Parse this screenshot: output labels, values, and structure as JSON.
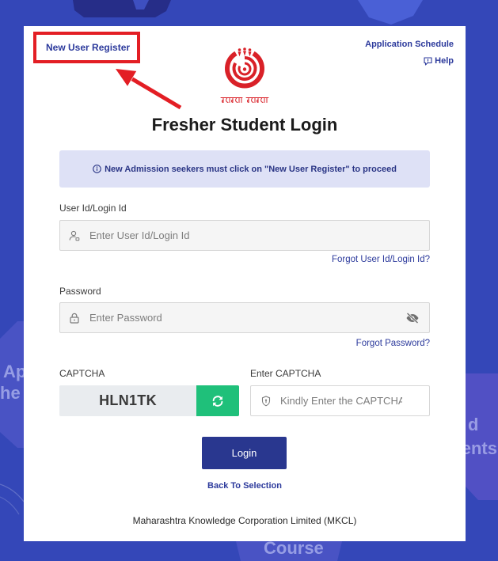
{
  "colors": {
    "page_background": "#3447b8",
    "link": "#2c3a9c",
    "highlight_red": "#e31e24",
    "notice_background": "#dee1f6",
    "notice_text": "#2a3585",
    "refresh_button": "#1fc07a",
    "login_button": "#29378f"
  },
  "background": {
    "left_text_1": "Ap",
    "left_text_2": "he",
    "right_text_1": "d",
    "right_text_2": "ents",
    "bottom_text": "Course"
  },
  "header": {
    "new_user_register": "New User Register",
    "application_schedule": "Application Schedule",
    "help": "Help",
    "help_icon": "help-icon"
  },
  "logo": {
    "icon": "university-logo",
    "tagline": "ज्ञानगंगा घरोघरी"
  },
  "title": "Fresher Student Login",
  "notice": {
    "icon": "info-icon",
    "text": "New Admission seekers must click on \"New User Register\" to proceed"
  },
  "form": {
    "user_id": {
      "label": "User Id/Login Id",
      "placeholder": "Enter User Id/Login Id",
      "value": "",
      "icon": "user-icon",
      "forgot_link": "Forgot User Id/Login Id?"
    },
    "password": {
      "label": "Password",
      "placeholder": "Enter Password",
      "value": "",
      "icon": "lock-icon",
      "toggle_icon": "eye-slash-icon",
      "forgot_link": "Forgot Password?"
    },
    "captcha": {
      "label": "CAPTCHA",
      "code": "HLN1TK",
      "refresh_icon": "refresh-icon"
    },
    "captcha_input": {
      "label": "Enter CAPTCHA",
      "placeholder": "Kindly Enter the CAPTCHA",
      "value": "",
      "icon": "shield-icon"
    },
    "login_button": "Login",
    "back_link": "Back To Selection"
  },
  "footer": {
    "text": "Maharashtra Knowledge Corporation Limited (MKCL)"
  }
}
